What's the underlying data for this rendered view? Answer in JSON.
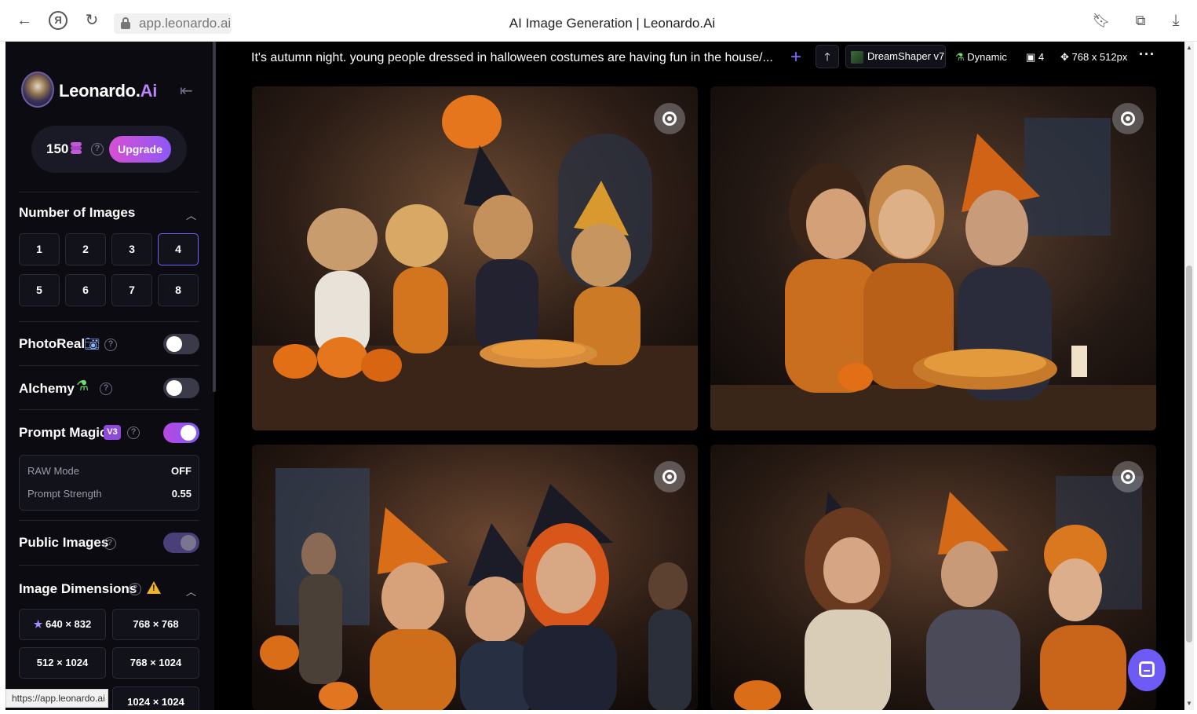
{
  "browser": {
    "url": "app.leonardo.ai",
    "tab_title": "AI Image Generation | Leonardo.Ai",
    "status_url": "https://app.leonardo.ai"
  },
  "sidebar": {
    "brand_main": "Leonardo.",
    "brand_accent": "Ai",
    "tokens": "150",
    "upgrade_label": "Upgrade",
    "number_of_images": {
      "title": "Number of Images",
      "options": [
        "1",
        "2",
        "3",
        "4",
        "5",
        "6",
        "7",
        "8"
      ],
      "selected": "4"
    },
    "photoreal": {
      "label": "PhotoReal",
      "enabled": false
    },
    "alchemy": {
      "label": "Alchemy",
      "enabled": false
    },
    "prompt_magic": {
      "label": "Prompt Magic",
      "version": "V3",
      "enabled": true,
      "raw_mode_label": "RAW Mode",
      "raw_mode_value": "OFF",
      "prompt_strength_label": "Prompt Strength",
      "prompt_strength_value": "0.55"
    },
    "public_images": {
      "label": "Public Images",
      "enabled": true
    },
    "image_dimensions": {
      "title": "Image Dimensions",
      "options": [
        "640 × 832",
        "768 × 768",
        "512 × 1024",
        "768 × 1024",
        "1024 × 1024"
      ]
    }
  },
  "generation": {
    "prompt": "It's autumn night. young people dressed in halloween costumes are having fun in the house/...",
    "model": "DreamShaper v7",
    "style": "Dynamic",
    "count": "4",
    "size": "768 x 512px",
    "more": "···"
  },
  "colors": {
    "accent_purple": "#7e5bf6",
    "upgrade_pink": "#d84fd4",
    "panel_bg": "#0b0b11"
  }
}
